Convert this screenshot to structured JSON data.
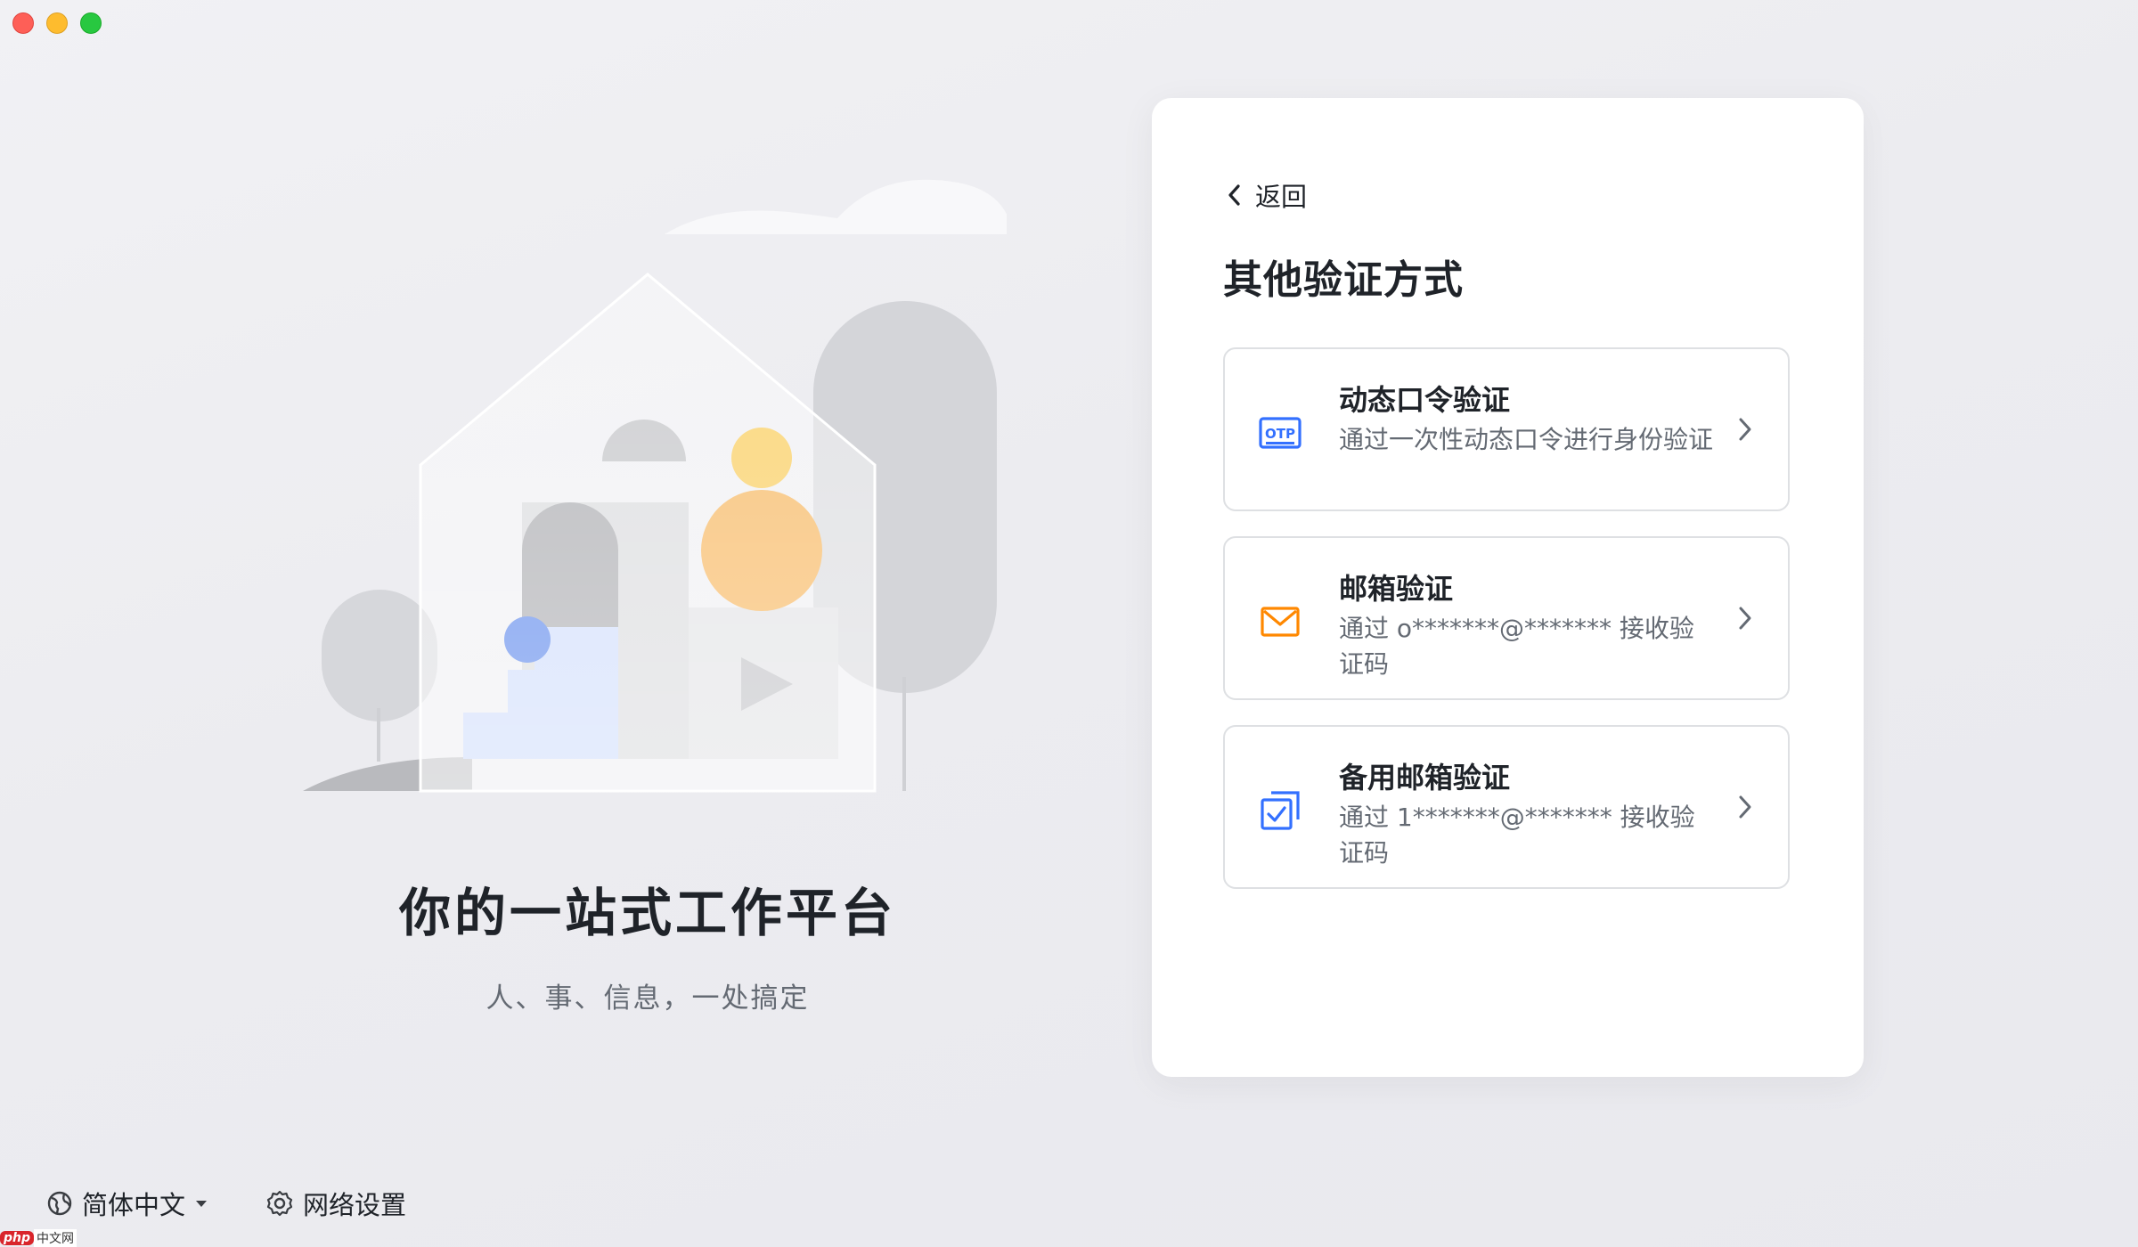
{
  "window": {
    "buttons": [
      "close",
      "minimize",
      "maximize"
    ]
  },
  "hero": {
    "slogan": "你的一站式工作平台",
    "subtitle": "人、事、信息，一处搞定"
  },
  "footer": {
    "language": "简体中文",
    "network": "网络设置",
    "language_icon": "globe-icon",
    "network_icon": "gear-icon"
  },
  "panel": {
    "back_label": "返回",
    "title": "其他验证方式",
    "options": [
      {
        "icon": "otp-icon",
        "title": "动态口令验证",
        "desc": "通过一次性动态口令进行身份验证",
        "accent": "#3370ff"
      },
      {
        "icon": "mail-icon",
        "title": "邮箱验证",
        "desc": "通过 o*******@******* 接收验证码",
        "accent": "#ff8800"
      },
      {
        "icon": "backup-mail-icon",
        "title": "备用邮箱验证",
        "desc": "通过 1*******@******* 接收验证码",
        "accent": "#3370ff"
      }
    ]
  },
  "watermark": {
    "badge": "php",
    "text": "中文网"
  },
  "colors": {
    "primary_text": "#1f2329",
    "secondary_text": "#646a73",
    "border": "#dee0e3",
    "orange": "#f5a83e",
    "yellow": "#f8c33c",
    "blue_dot": "#3b6fe8",
    "light_blue": "#c6d6fb"
  }
}
